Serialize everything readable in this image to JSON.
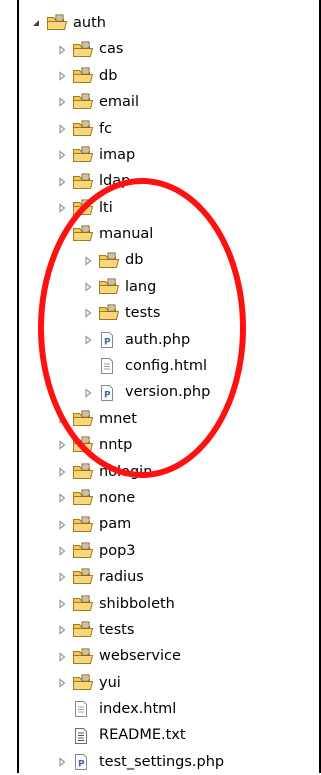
{
  "colors": {
    "annotation": "#ff1111",
    "folder_fill": "#f3c85e",
    "folder_stroke": "#a8781a",
    "pkg_icon": "#3c64b4"
  },
  "tree": [
    {
      "label": "auth",
      "level": 0,
      "expanded": true,
      "icon": "package-folder-icon"
    },
    {
      "label": "cas",
      "level": 1,
      "expanded": false,
      "icon": "package-folder-icon"
    },
    {
      "label": "db",
      "level": 1,
      "expanded": false,
      "icon": "package-folder-icon"
    },
    {
      "label": "email",
      "level": 1,
      "expanded": false,
      "icon": "package-folder-icon"
    },
    {
      "label": "fc",
      "level": 1,
      "expanded": false,
      "icon": "package-folder-icon"
    },
    {
      "label": "imap",
      "level": 1,
      "expanded": false,
      "icon": "package-folder-icon"
    },
    {
      "label": "ldap",
      "level": 1,
      "expanded": false,
      "icon": "package-folder-icon"
    },
    {
      "label": "lti",
      "level": 1,
      "expanded": false,
      "icon": "package-folder-icon"
    },
    {
      "label": "manual",
      "level": 1,
      "expanded": true,
      "icon": "package-folder-icon"
    },
    {
      "label": "db",
      "level": 2,
      "expanded": false,
      "icon": "package-folder-icon"
    },
    {
      "label": "lang",
      "level": 2,
      "expanded": false,
      "icon": "package-folder-icon"
    },
    {
      "label": "tests",
      "level": 2,
      "expanded": false,
      "icon": "package-folder-icon"
    },
    {
      "label": "auth.php",
      "level": 2,
      "expanded": false,
      "icon": "php-file-icon"
    },
    {
      "label": "config.html",
      "level": 2,
      "expanded": null,
      "icon": "html-file-icon"
    },
    {
      "label": "version.php",
      "level": 2,
      "expanded": false,
      "icon": "php-file-icon"
    },
    {
      "label": "mnet",
      "level": 1,
      "expanded": false,
      "icon": "package-folder-icon"
    },
    {
      "label": "nntp",
      "level": 1,
      "expanded": false,
      "icon": "package-folder-icon"
    },
    {
      "label": "nologin",
      "level": 1,
      "expanded": false,
      "icon": "package-folder-icon"
    },
    {
      "label": "none",
      "level": 1,
      "expanded": false,
      "icon": "package-folder-icon"
    },
    {
      "label": "pam",
      "level": 1,
      "expanded": false,
      "icon": "package-folder-icon"
    },
    {
      "label": "pop3",
      "level": 1,
      "expanded": false,
      "icon": "package-folder-icon"
    },
    {
      "label": "radius",
      "level": 1,
      "expanded": false,
      "icon": "package-folder-icon"
    },
    {
      "label": "shibboleth",
      "level": 1,
      "expanded": false,
      "icon": "package-folder-icon"
    },
    {
      "label": "tests",
      "level": 1,
      "expanded": false,
      "icon": "package-folder-icon"
    },
    {
      "label": "webservice",
      "level": 1,
      "expanded": false,
      "icon": "package-folder-icon"
    },
    {
      "label": "yui",
      "level": 1,
      "expanded": false,
      "icon": "package-folder-icon"
    },
    {
      "label": "index.html",
      "level": 1,
      "expanded": null,
      "icon": "html-file-icon"
    },
    {
      "label": "README.txt",
      "level": 1,
      "expanded": null,
      "icon": "text-file-icon"
    },
    {
      "label": "test_settings.php",
      "level": 1,
      "expanded": false,
      "icon": "php-file-icon"
    }
  ]
}
